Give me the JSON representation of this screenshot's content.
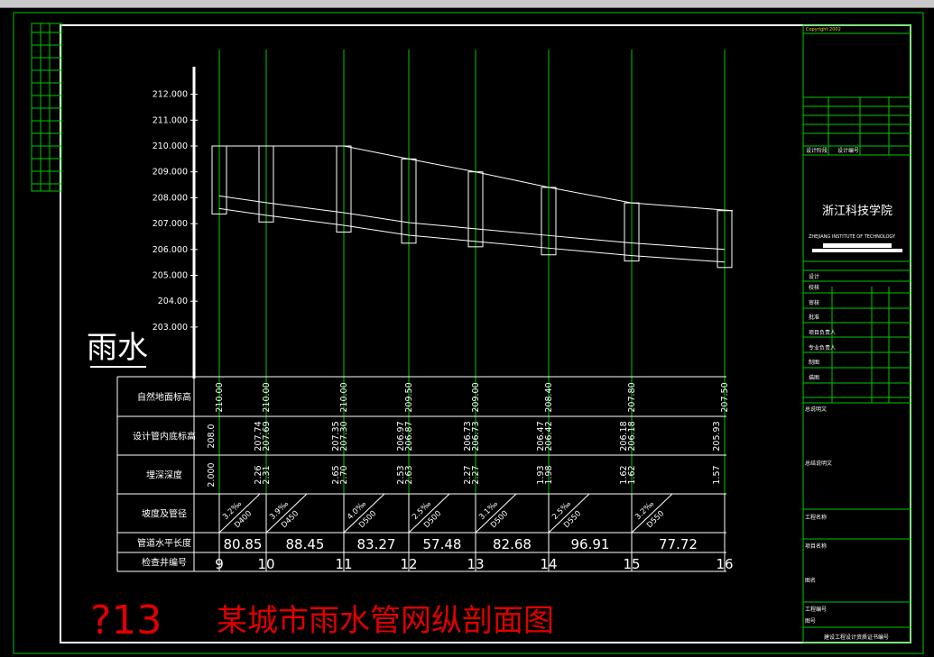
{
  "colors": {
    "background": "#000000",
    "grid": "#00c800",
    "lines": "#ffffff",
    "title": "#e00000"
  },
  "profile": {
    "watermark_label": "雨水",
    "elevation_ticks": [
      "212.000",
      "211.000",
      "210.000",
      "209.000",
      "208.000",
      "207.000",
      "206.000",
      "205.000",
      "204.00",
      "203.000"
    ],
    "elevation_values": [
      212,
      211,
      210,
      209,
      208,
      207,
      206,
      205,
      204,
      203
    ],
    "stations": [
      {
        "node": "9",
        "ground": 210.0,
        "pipe_in": 208.0,
        "pipe_out": 208.0
      },
      {
        "node": "10",
        "ground": 210.0,
        "pipe_in": 207.74,
        "pipe_out": 207.69
      },
      {
        "node": "11",
        "ground": 210.0,
        "pipe_in": 207.35,
        "pipe_out": 207.3
      },
      {
        "node": "12",
        "ground": 209.5,
        "pipe_in": 206.97,
        "pipe_out": 206.87
      },
      {
        "node": "13",
        "ground": 209.0,
        "pipe_in": 206.73,
        "pipe_out": 206.73
      },
      {
        "node": "14",
        "ground": 208.4,
        "pipe_in": 206.47,
        "pipe_out": 206.42
      },
      {
        "node": "15",
        "ground": 207.8,
        "pipe_in": 206.18,
        "pipe_out": 206.18
      },
      {
        "node": "16",
        "ground": 207.5,
        "pipe_in": 205.93,
        "pipe_out": 205.93
      }
    ]
  },
  "table": {
    "row_labels": [
      "自然地面标高",
      "设计管内底标高",
      "埋深深度",
      "坡度及管径",
      "管道水平长度",
      "检查井编号"
    ],
    "ground_elev": [
      "210.00",
      "210.00",
      "210.00",
      "209.50",
      "209.00",
      "208.40",
      "207.80",
      "207.50"
    ],
    "invert_elev": [
      [
        "208.0"
      ],
      [
        "207.74",
        "207.69"
      ],
      [
        "207.35",
        "207.30"
      ],
      [
        "206.97",
        "206.87"
      ],
      [
        "206.73",
        "206.73"
      ],
      [
        "206.47",
        "206.42"
      ],
      [
        "206.18",
        "206.18"
      ],
      [
        "205.93"
      ]
    ],
    "burial_depth": [
      [
        "2.000"
      ],
      [
        "2.26",
        "2.31"
      ],
      [
        "2.65",
        "2.70"
      ],
      [
        "2.53",
        "2.63"
      ],
      [
        "2.27",
        "2.27"
      ],
      [
        "1.93",
        "1.98"
      ],
      [
        "1.62",
        "1.62"
      ],
      [
        "1.57"
      ]
    ],
    "slopes": [
      "3.2‰",
      "3.9‰",
      "4.0‰",
      "2.5‰",
      "3.1‰",
      "2.5‰",
      "3.2‰"
    ],
    "diameters": [
      "D400",
      "D450",
      "D500",
      "D500",
      "D500",
      "D550",
      "D550"
    ],
    "lengths": [
      "80.85",
      "88.45",
      "83.27",
      "57.48",
      "82.68",
      "96.91",
      "77.72"
    ],
    "wells": [
      "9",
      "10",
      "11",
      "12",
      "13",
      "14",
      "15",
      "16"
    ]
  },
  "drawing": {
    "number": "?13",
    "title": "某城市雨水管网纵剖面图"
  },
  "title_block": {
    "copyright": "Copyright 2002",
    "school_cn": "浙江科技学院",
    "school_en": "ZHEJIANG INSTITUTE OF TECHNOLOGY",
    "mid_labels": [
      "设计阶段",
      "设计编号"
    ],
    "sign_labels": [
      "设计",
      "校核",
      "审核",
      "批准",
      "项目负责人",
      "专业负责人",
      "制图",
      "描图"
    ],
    "section_labels": [
      "总说明文",
      "总结说明文",
      "工程名称",
      "项目名称",
      "图名",
      "工程编号",
      "图号"
    ],
    "footer": "建设工程设计资质证书编号"
  }
}
